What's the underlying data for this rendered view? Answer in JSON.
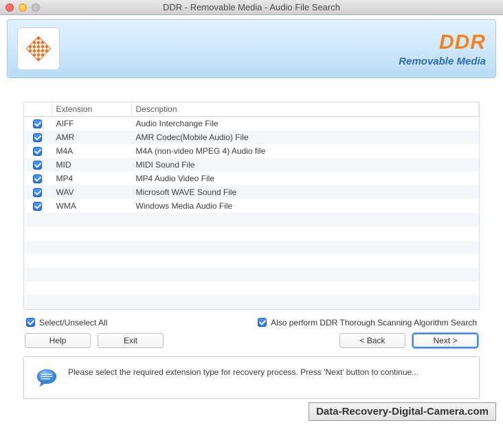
{
  "window": {
    "title": "DDR - Removable Media - Audio File Search"
  },
  "brand": {
    "title": "DDR",
    "subtitle": "Removable Media"
  },
  "table": {
    "headers": {
      "checkbox": "",
      "extension": "Extension",
      "description": "Description"
    },
    "rows": [
      {
        "checked": true,
        "ext": "AIFF",
        "desc": "Audio Interchange File"
      },
      {
        "checked": true,
        "ext": "AMR",
        "desc": "AMR Codec(Mobile Audio) File"
      },
      {
        "checked": true,
        "ext": "M4A",
        "desc": "M4A (non-video MPEG 4) Audio file"
      },
      {
        "checked": true,
        "ext": "MID",
        "desc": "MIDI Sound File"
      },
      {
        "checked": true,
        "ext": "MP4",
        "desc": "MP4 Audio Video File"
      },
      {
        "checked": true,
        "ext": "WAV",
        "desc": "Microsoft WAVE Sound File"
      },
      {
        "checked": true,
        "ext": "WMA",
        "desc": "Windows Media Audio File"
      }
    ],
    "empty_rows": 7
  },
  "options": {
    "select_all": {
      "checked": true,
      "label": "Select/Unselect All"
    },
    "thorough": {
      "checked": true,
      "label": "Also perform DDR Thorough Scanning Algorithm Search"
    }
  },
  "buttons": {
    "help": "Help",
    "exit": "Exit",
    "back": "< Back",
    "next": "Next >"
  },
  "info": {
    "text": "Please select the required extension type for recovery process. Press 'Next' button to continue..."
  },
  "watermark": "Data-Recovery-Digital-Camera.com"
}
